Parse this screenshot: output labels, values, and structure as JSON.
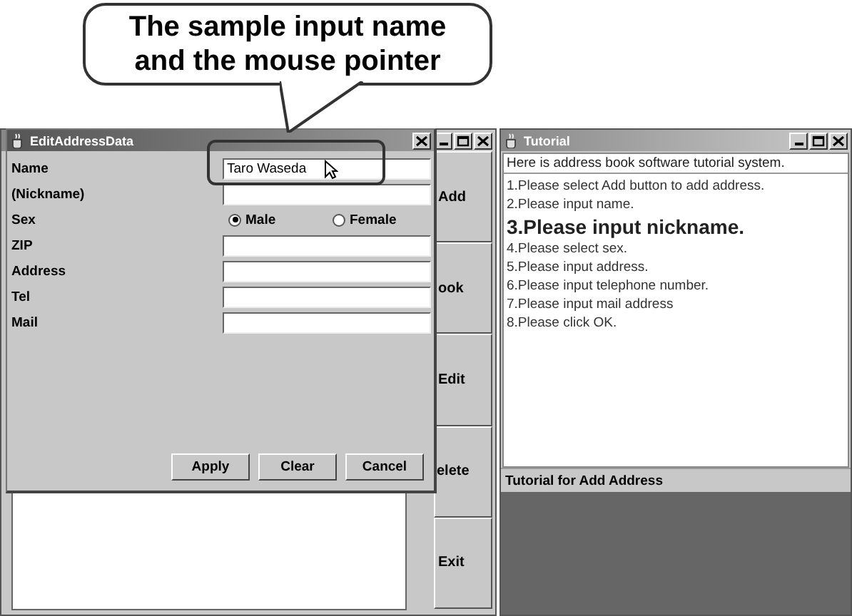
{
  "callout": {
    "text": "The sample input name and the mouse pointer"
  },
  "main_window": {
    "buttons": [
      {
        "label": "Add"
      },
      {
        "label": "ook"
      },
      {
        "label": "Edit"
      },
      {
        "label": "elete"
      },
      {
        "label": "Exit"
      }
    ]
  },
  "edit_dialog": {
    "title": "EditAddressData",
    "fields": [
      {
        "label": "Name",
        "kind": "text",
        "value": "Taro Waseda",
        "highlighted": true,
        "pointer": true
      },
      {
        "label": "(Nickname)",
        "kind": "text",
        "highlighted": false,
        "pointer": false
      },
      {
        "label": "Sex",
        "kind": "radio",
        "options": [
          {
            "label": "Male",
            "selected": true
          },
          {
            "label": "Female",
            "selected": false
          }
        ]
      },
      {
        "label": "ZIP",
        "kind": "text",
        "highlighted": false,
        "pointer": false
      },
      {
        "label": "Address",
        "kind": "text",
        "highlighted": false,
        "pointer": false
      },
      {
        "label": "Tel",
        "kind": "text",
        "highlighted": false,
        "pointer": false
      },
      {
        "label": "Mail",
        "kind": "text",
        "highlighted": false,
        "pointer": false
      }
    ],
    "buttons": [
      "Apply",
      "Clear",
      "Cancel"
    ]
  },
  "tutorial": {
    "title": "Tutorial",
    "intro": "Here is address book software tutorial system.",
    "steps": [
      {
        "text": "1.Please select Add button to add address.",
        "current": false
      },
      {
        "text": "2.Please input name.",
        "current": false
      },
      {
        "text": "3.Please input nickname.",
        "current": true
      },
      {
        "text": "4.Please select sex.",
        "current": false
      },
      {
        "text": "5.Please input address.",
        "current": false
      },
      {
        "text": "6.Please input telephone number.",
        "current": false
      },
      {
        "text": "7.Please input mail address",
        "current": false
      },
      {
        "text": "8.Please click OK.",
        "current": false
      }
    ],
    "status": "Tutorial for Add Address"
  }
}
